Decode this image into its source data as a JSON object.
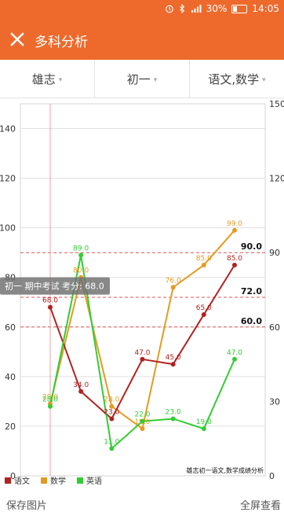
{
  "status_bar": {
    "battery": "30%",
    "battery_level": 0.3,
    "time": "14:05"
  },
  "app_bar": {
    "title": "多科分析"
  },
  "filters": {
    "student": "雄志",
    "grade": "初一",
    "subjects": "语文,数学"
  },
  "actions": {
    "save": "保存图片",
    "fullscreen": "全屏查看"
  },
  "chart_data": {
    "type": "line",
    "caption": "雄志初一语文,数学成绩分析",
    "tooltip": "初一 期中考试 考分: 68.0",
    "y_left": {
      "ticks": [
        0,
        20,
        40,
        60,
        80,
        100,
        120,
        140
      ],
      "range": [
        0,
        150
      ]
    },
    "y_right": {
      "ticks": [
        0,
        30,
        60,
        90,
        120,
        150
      ],
      "range": [
        0,
        150
      ]
    },
    "reference_lines": [
      {
        "value": 90,
        "label": "90.0"
      },
      {
        "value": 72,
        "label": "72.0"
      },
      {
        "value": 60,
        "label": "60.0"
      }
    ],
    "series": [
      {
        "name": "语文",
        "color": "#b22222",
        "values": [
          68,
          34,
          23,
          47,
          45,
          65,
          85
        ],
        "labels": [
          "68.0",
          "34.0",
          "23.0",
          "47.0",
          "45.0",
          "65.0",
          "85.0"
        ]
      },
      {
        "name": "数学",
        "color": "#e39b22",
        "values": [
          29,
          80,
          28,
          19,
          76,
          85,
          99
        ],
        "labels": [
          "29.0",
          "80.0",
          "28.0",
          "19.0",
          "76.0",
          "85.0",
          "99.0"
        ]
      },
      {
        "name": "英语",
        "color": "#33cc33",
        "values": [
          28,
          89,
          11,
          22,
          23,
          19,
          47
        ],
        "labels": [
          "28.0",
          "89.0",
          "11.0",
          "22.0",
          "23.0",
          "19.0",
          "47.0"
        ]
      }
    ]
  }
}
